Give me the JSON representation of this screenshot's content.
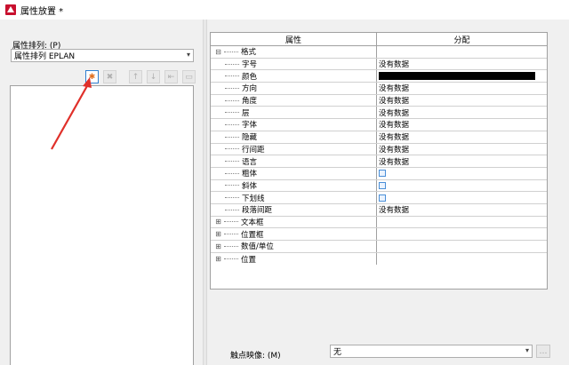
{
  "window": {
    "title": "属性放置 *"
  },
  "left": {
    "sort_label": "属性排列: (P)",
    "sort_value": "属性排列 EPLAN",
    "toolbar": [
      {
        "name": "new-button",
        "icon": "new-icon",
        "glyph": "✱"
      },
      {
        "name": "delete-button",
        "icon": "delete-icon",
        "glyph": "✖"
      },
      {
        "name": "move-up-button",
        "icon": "arrow-up-icon",
        "glyph": "↑"
      },
      {
        "name": "move-down-button",
        "icon": "arrow-down-icon",
        "glyph": "↓"
      },
      {
        "name": "import-button",
        "icon": "import-icon",
        "glyph": "⇤"
      },
      {
        "name": "export-button",
        "icon": "export-icon",
        "glyph": "▭"
      }
    ]
  },
  "grid": {
    "col_property": "属性",
    "col_assignment": "分配",
    "rows": [
      {
        "level": 0,
        "expander": "⊟",
        "label": "格式",
        "value": "",
        "type": "group"
      },
      {
        "level": 1,
        "label": "字号",
        "value": "没有数据",
        "type": "text"
      },
      {
        "level": 1,
        "label": "颜色",
        "value": "#000000",
        "type": "color"
      },
      {
        "level": 1,
        "label": "方向",
        "value": "没有数据",
        "type": "text"
      },
      {
        "level": 1,
        "label": "角度",
        "value": "没有数据",
        "type": "text"
      },
      {
        "level": 1,
        "label": "层",
        "value": "没有数据",
        "type": "text"
      },
      {
        "level": 1,
        "label": "字体",
        "value": "没有数据",
        "type": "text"
      },
      {
        "level": 1,
        "label": "隐藏",
        "value": "没有数据",
        "type": "text"
      },
      {
        "level": 1,
        "label": "行间距",
        "value": "没有数据",
        "type": "text"
      },
      {
        "level": 1,
        "label": "语言",
        "value": "没有数据",
        "type": "text"
      },
      {
        "level": 1,
        "label": "粗体",
        "value": "",
        "type": "checkbox"
      },
      {
        "level": 1,
        "label": "斜体",
        "value": "",
        "type": "checkbox"
      },
      {
        "level": 1,
        "label": "下划线",
        "value": "",
        "type": "checkbox"
      },
      {
        "level": 1,
        "label": "段落间距",
        "value": "没有数据",
        "type": "text"
      },
      {
        "level": 0,
        "expander": "⊞",
        "label": "文本框",
        "value": "",
        "type": "group"
      },
      {
        "level": 0,
        "expander": "⊞",
        "label": "位置框",
        "value": "",
        "type": "group"
      },
      {
        "level": 0,
        "expander": "⊞",
        "label": "数值/单位",
        "value": "",
        "type": "group"
      },
      {
        "level": 0,
        "expander": "⊞",
        "label": "位置",
        "value": "",
        "type": "group"
      }
    ]
  },
  "touch": {
    "label": "触点映像: (M)",
    "value": "无",
    "btn_glyph": "…"
  },
  "colors": {
    "annotation_arrow": "#e0302a",
    "focus": "#2f7fd0"
  }
}
